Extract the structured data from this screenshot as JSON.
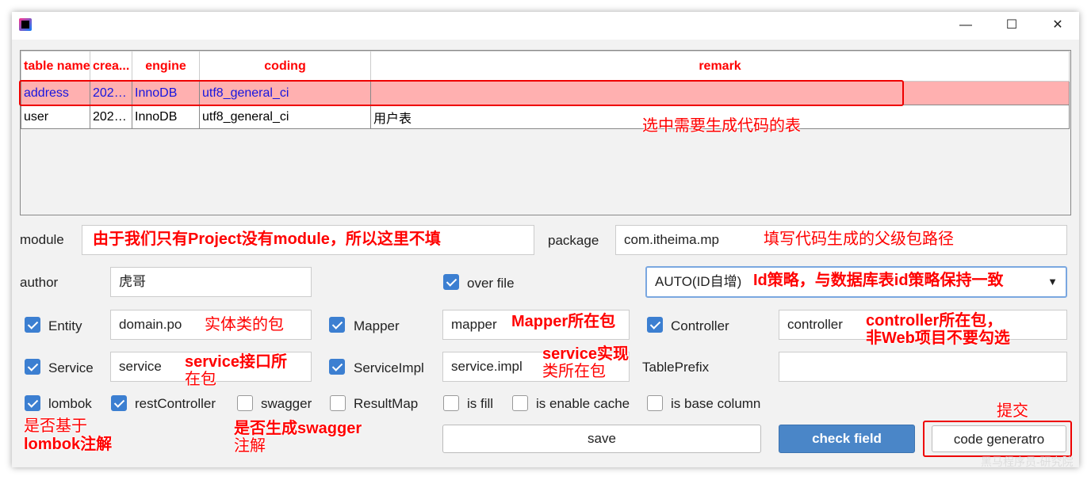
{
  "window": {
    "minimize": "—",
    "maximize": "☐",
    "close": "✕"
  },
  "table": {
    "columns": [
      "table name",
      "crea...",
      "engine",
      "coding",
      "remark"
    ],
    "rows": [
      [
        "address",
        "202…",
        "InnoDB",
        "utf8_general_ci",
        ""
      ],
      [
        "user",
        "202…",
        "InnoDB",
        "utf8_general_ci",
        "用户表"
      ]
    ]
  },
  "form": {
    "module_label": "module",
    "module_value": "",
    "package_label": "package",
    "package_value": "com.itheima.mp",
    "author_label": "author",
    "author_value": "虎哥",
    "over_file": {
      "label": "over file",
      "checked": true
    },
    "id_strategy": "AUTO(ID自增)",
    "entity": {
      "label": "Entity",
      "checked": true,
      "value": "domain.po"
    },
    "mapper": {
      "label": "Mapper",
      "checked": true,
      "value": "mapper"
    },
    "controller": {
      "label": "Controller",
      "checked": true,
      "value": "controller"
    },
    "service": {
      "label": "Service",
      "checked": true,
      "value": "service"
    },
    "service_impl": {
      "label": "ServiceImpl",
      "checked": true,
      "value": "service.impl"
    },
    "table_prefix": {
      "label": "TablePrefix",
      "value": ""
    },
    "options": [
      {
        "label": "lombok",
        "checked": true
      },
      {
        "label": "restController",
        "checked": true
      },
      {
        "label": "swagger",
        "checked": false
      },
      {
        "label": "ResultMap",
        "checked": false
      },
      {
        "label": "is fill",
        "checked": false
      },
      {
        "label": "is enable cache",
        "checked": false
      },
      {
        "label": "is base column",
        "checked": false
      }
    ]
  },
  "buttons": {
    "save": "save",
    "check_field": "check field",
    "code_generator": "code generatro"
  },
  "annotations": {
    "select_table": "选中需要生成代码的表",
    "module": "由于我们只有Project没有module，所以这里不填",
    "package": "填写代码生成的父级包路径",
    "id": "Id策略，与数据库表id策略保持一致",
    "entity": "实体类的包",
    "mapper": "Mapper所在包",
    "controller1": "controller所在包，",
    "controller2": "非Web项目不要勾选",
    "service1": "service接口所",
    "service2": "在包",
    "impl1": "service实现",
    "impl2": "类所在包",
    "lombok1": "是否基于",
    "lombok2": "lombok注解",
    "swagger1": "是否生成swagger",
    "swagger2": "注解",
    "submit": "提交"
  },
  "watermark": "黑马程序员-研究院",
  "colors": {
    "accent": "#3c7fd1",
    "annotation": "#ff0000",
    "selected_row": "#ffb0b0"
  }
}
